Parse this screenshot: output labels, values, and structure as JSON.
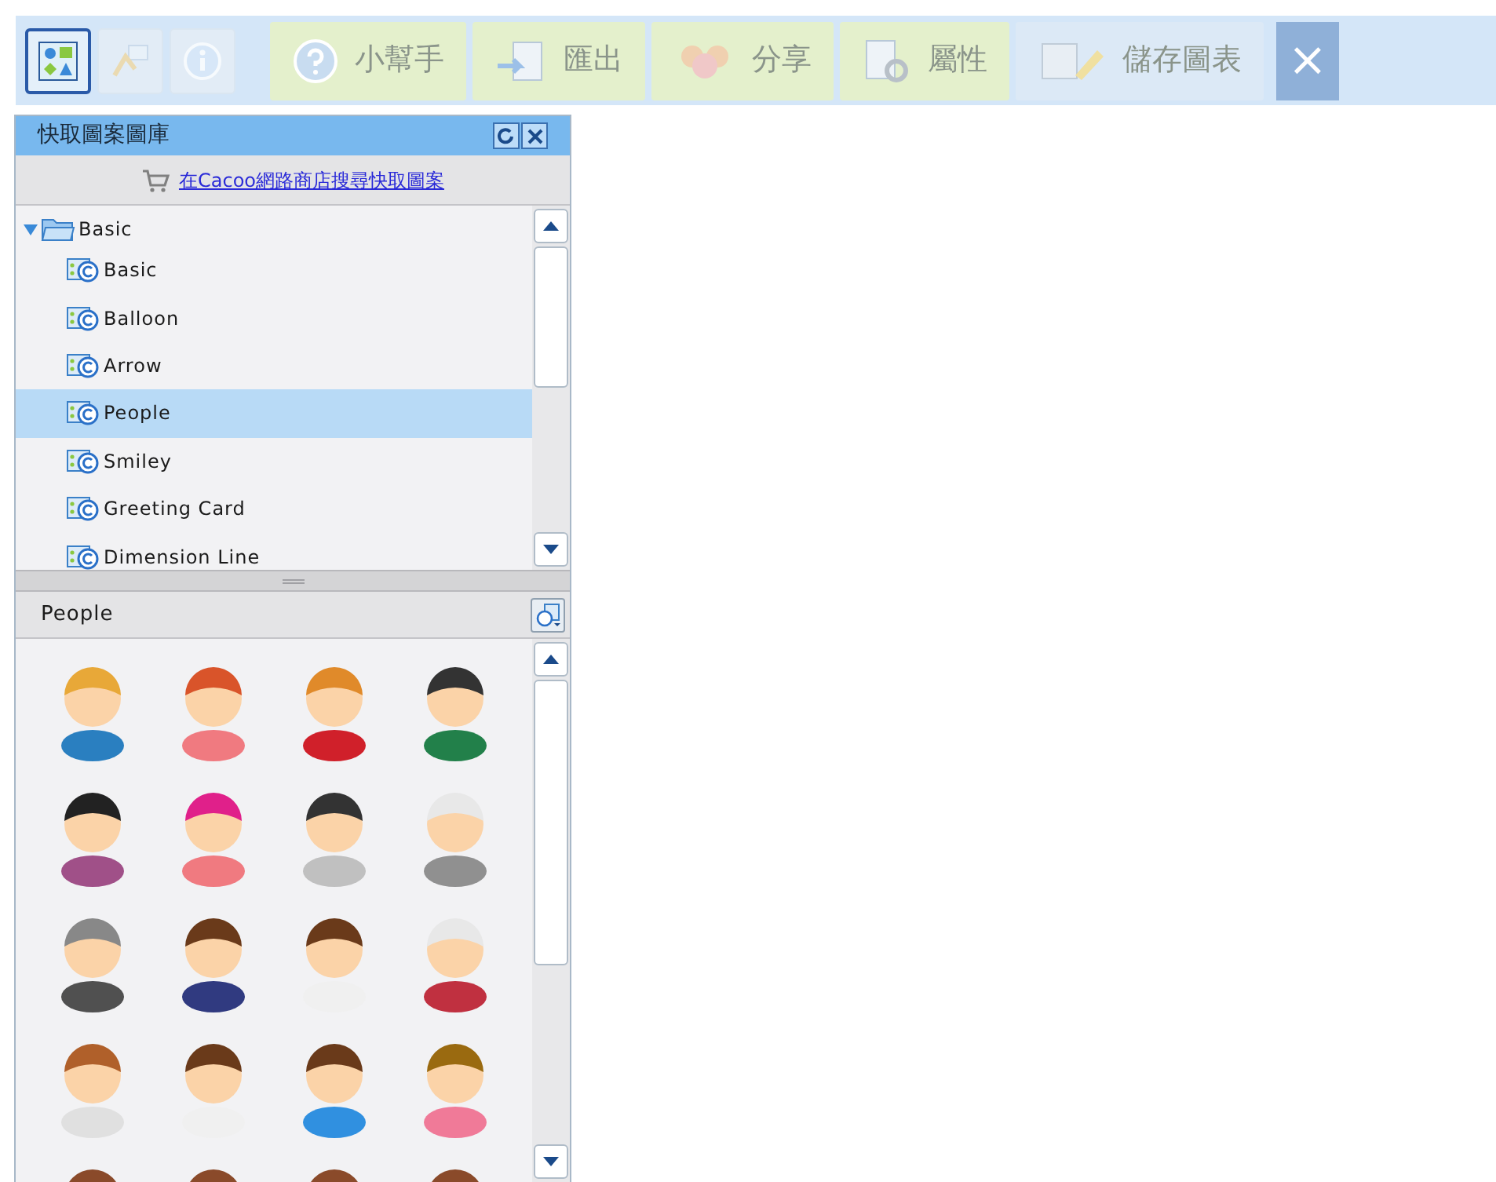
{
  "toolbar": {
    "toggles": [
      {
        "selected": true
      },
      {
        "selected": false
      },
      {
        "selected": false
      }
    ],
    "buttons": [
      {
        "label": "小幫手",
        "kind": "help",
        "disabled": true
      },
      {
        "label": "匯出",
        "kind": "export",
        "disabled": true
      },
      {
        "label": "分享",
        "kind": "share",
        "disabled": true
      },
      {
        "label": "屬性",
        "kind": "properties",
        "disabled": true
      },
      {
        "label": "儲存圖表",
        "kind": "save",
        "disabled": true
      }
    ],
    "close": "×"
  },
  "panel": {
    "title": "快取圖案圖庫",
    "store_link": "在Cacoo網路商店搜尋快取圖案",
    "tree": {
      "label": "Basic",
      "expanded": true,
      "children": [
        {
          "label": "Basic",
          "selected": false
        },
        {
          "label": "Balloon",
          "selected": false
        },
        {
          "label": "Arrow",
          "selected": false
        },
        {
          "label": "People",
          "selected": true
        },
        {
          "label": "Smiley",
          "selected": false
        },
        {
          "label": "Greeting Card",
          "selected": false
        },
        {
          "label": "Dimension Line",
          "selected": false
        }
      ]
    },
    "gallery_title": "People"
  }
}
